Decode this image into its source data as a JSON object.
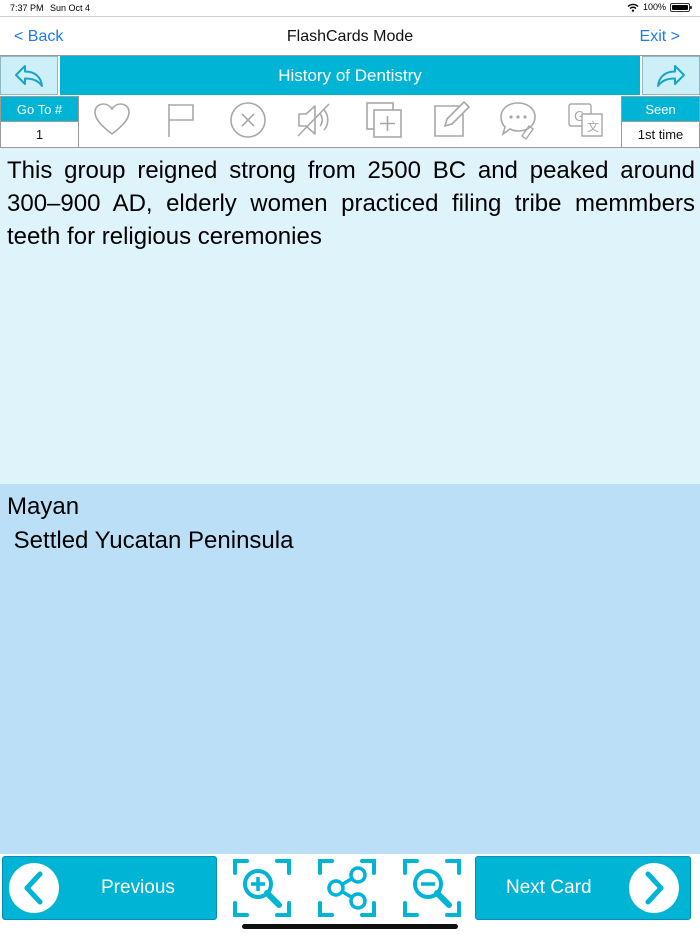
{
  "status_bar": {
    "time": "7:37 PM",
    "date": "Sun Oct 4",
    "battery": "100%"
  },
  "nav": {
    "back_label": "< Back",
    "title": "FlashCards Mode",
    "exit_label": "Exit >"
  },
  "deck": {
    "title": "History of Dentistry"
  },
  "toolbar": {
    "goto_label": "Go To #",
    "goto_value": "1",
    "seen_label": "Seen",
    "seen_value": "1st time",
    "icons": [
      "heart-icon",
      "flag-icon",
      "delete-icon",
      "mute-icon",
      "add-card-icon",
      "edit-icon",
      "comment-icon",
      "translate-icon"
    ]
  },
  "card": {
    "question": "This group reigned strong from 2500 BC and peaked around 300–900 AD, elderly women practiced filing tribe memmbers teeth for religious ceremonies",
    "answer": "Mayan\n Settled Yucatan Peninsula"
  },
  "bottom": {
    "previous_label": "Previous",
    "next_label": "Next Card",
    "icons": [
      "zoom-in-icon",
      "share-icon",
      "zoom-out-icon"
    ]
  },
  "colors": {
    "accent": "#00b4d6",
    "link": "#1a7cf0",
    "question_bg": "#dff3fb",
    "answer_bg": "#bcdff8"
  }
}
